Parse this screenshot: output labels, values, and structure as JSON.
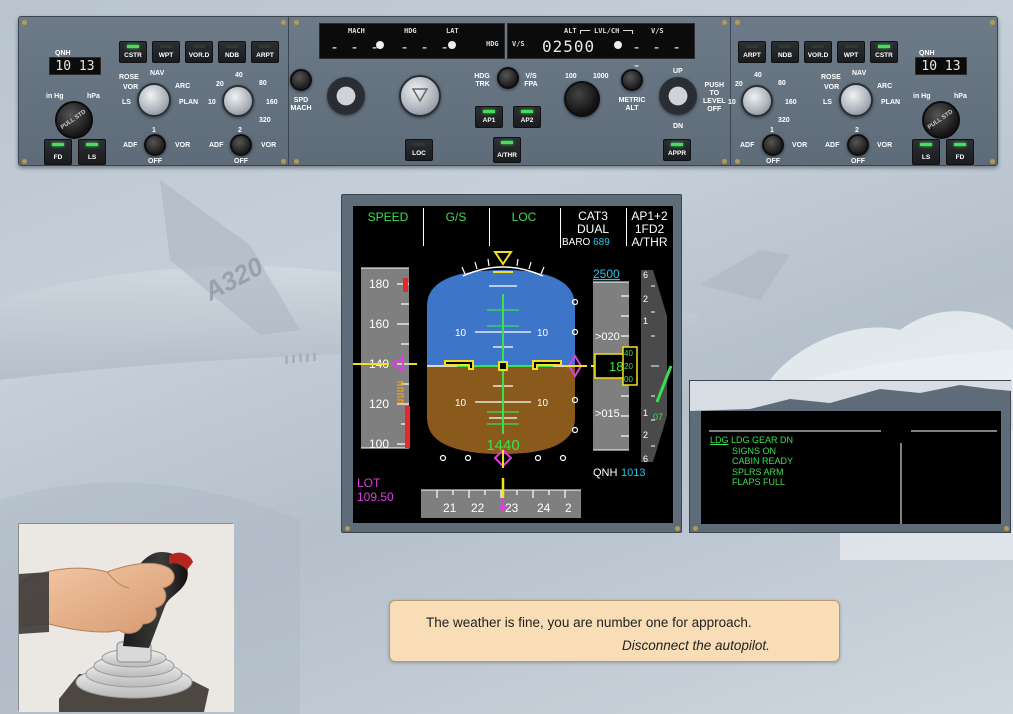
{
  "fcu": {
    "left": {
      "qnh_label": "QNH",
      "qnh_value": "10 13",
      "baro_units": [
        "in Hg",
        "hPa"
      ],
      "baro_knob": "PULL STD",
      "buttons": {
        "cstr": "CSTR",
        "wpt": "WPT",
        "vord": "VOR.D",
        "ndb": "NDB",
        "arpt": "ARPT",
        "fd": "FD",
        "ls": "LS"
      },
      "mode_labels": {
        "rose": "ROSE",
        "nav": "NAV",
        "vor": "VOR",
        "arc": "ARC",
        "ls": "LS",
        "plan": "PLAN"
      },
      "range_labels": [
        "20",
        "40",
        "80",
        "10",
        "160",
        "320"
      ],
      "selector_labels": {
        "adf1": "ADF",
        "vor1": "VOR",
        "off1": "OFF",
        "num1": "1",
        "adf2": "ADF",
        "vor2": "VOR",
        "off2": "OFF",
        "num2": "2"
      }
    },
    "center": {
      "mach_label": "MACH",
      "hdg_label": "HDG",
      "lat_label": "LAT",
      "speed_display": "- - -",
      "hdg_display": "- - -",
      "hdg_vs_label": "HDG",
      "vs_label_small": "V/S",
      "alt_label": "ALT",
      "lvlch_label": "LVL/CH",
      "vs_label": "V/S",
      "alt_display": "02500",
      "vs_display": "- - - -",
      "spd_mach_label": "SPD\nMACH",
      "hdg_trk_label": "HDG\nTRK",
      "vs_fpa_label": "V/S\nFPA",
      "metric_alt_label": "METRIC\nALT",
      "alt_range": [
        "100",
        "1000"
      ],
      "up_label": "UP",
      "dn_label": "DN",
      "push_label": "PUSH\nTO\nLEVEL\nOFF",
      "buttons": {
        "loc": "LOC",
        "ap1": "AP1",
        "ap2": "AP2",
        "athr": "A/THR",
        "appr": "APPR"
      }
    },
    "right": {
      "qnh_label": "QNH",
      "qnh_value": "10 13",
      "baro_units": [
        "in Hg",
        "hPa"
      ],
      "baro_knob": "PULL STD",
      "buttons": {
        "arpt": "ARPT",
        "ndb": "NDB",
        "vord": "VOR.D",
        "wpt": "WPT",
        "cstr": "CSTR",
        "ls": "LS",
        "fd": "FD"
      },
      "mode_labels": {
        "rose": "ROSE",
        "nav": "NAV",
        "vor": "VOR",
        "arc": "ARC",
        "ls": "LS",
        "plan": "PLAN"
      },
      "range_labels": [
        "20",
        "40",
        "80",
        "10",
        "160",
        "320"
      ],
      "selector_labels": {
        "adf1": "ADF",
        "vor1": "VOR",
        "off1": "OFF",
        "num1": "1",
        "adf2": "ADF",
        "vor2": "VOR",
        "off2": "OFF",
        "num2": "2"
      }
    }
  },
  "pfd": {
    "fma": {
      "speed": "SPEED",
      "gs": "G/S",
      "loc": "LOC",
      "cat_line1": "CAT3",
      "cat_line2": "DUAL",
      "baro_label": "BARO",
      "baro_value": "689",
      "ap_line1": "AP1+2",
      "ap_line2": "1FD2",
      "ap_line3": "A/THR"
    },
    "speed_ticks": [
      "180",
      "160",
      "140",
      "120",
      "100"
    ],
    "current_speed": "140",
    "pitch_labels": [
      "10",
      "10",
      "10",
      "10"
    ],
    "radio_alt": "1440",
    "ils_ident": "LOT",
    "ils_freq": "109.50",
    "selected_alt": "2500",
    "alt_ticks": [
      ">020",
      ">015"
    ],
    "current_alt": [
      "18",
      "2"
    ],
    "alt_window_right": [
      "40",
      "20",
      "00"
    ],
    "vs_ticks": [
      "6",
      "2",
      "1",
      "1",
      "2",
      "6"
    ],
    "vs_value": "07",
    "qnh_label": "QNH",
    "qnh_value": "1013",
    "heading_ticks": [
      "21",
      "22",
      "23",
      "24",
      "2"
    ]
  },
  "ecam": {
    "memo": {
      "ldg_prefix": "LDG",
      "ldg_gear": " LDG GEAR DN",
      "signs": "SIGNS ON",
      "cabin": "CABIN READY",
      "splrs": "SPLRS ARM",
      "flaps": "FLAPS FULL"
    }
  },
  "aircraft_text": "A320",
  "message": {
    "line1": "The weather is fine, you are number one for approach.",
    "line2": "Disconnect the autopilot."
  },
  "colors": {
    "pfd_green": "#3be04e",
    "pfd_cyan": "#25c6e6",
    "pfd_magenta": "#e23ce2",
    "pfd_yellow": "#f2e11c",
    "sky": "#3d76c9",
    "ground": "#8a5a1c",
    "message_bg": "#f8ddb7"
  }
}
